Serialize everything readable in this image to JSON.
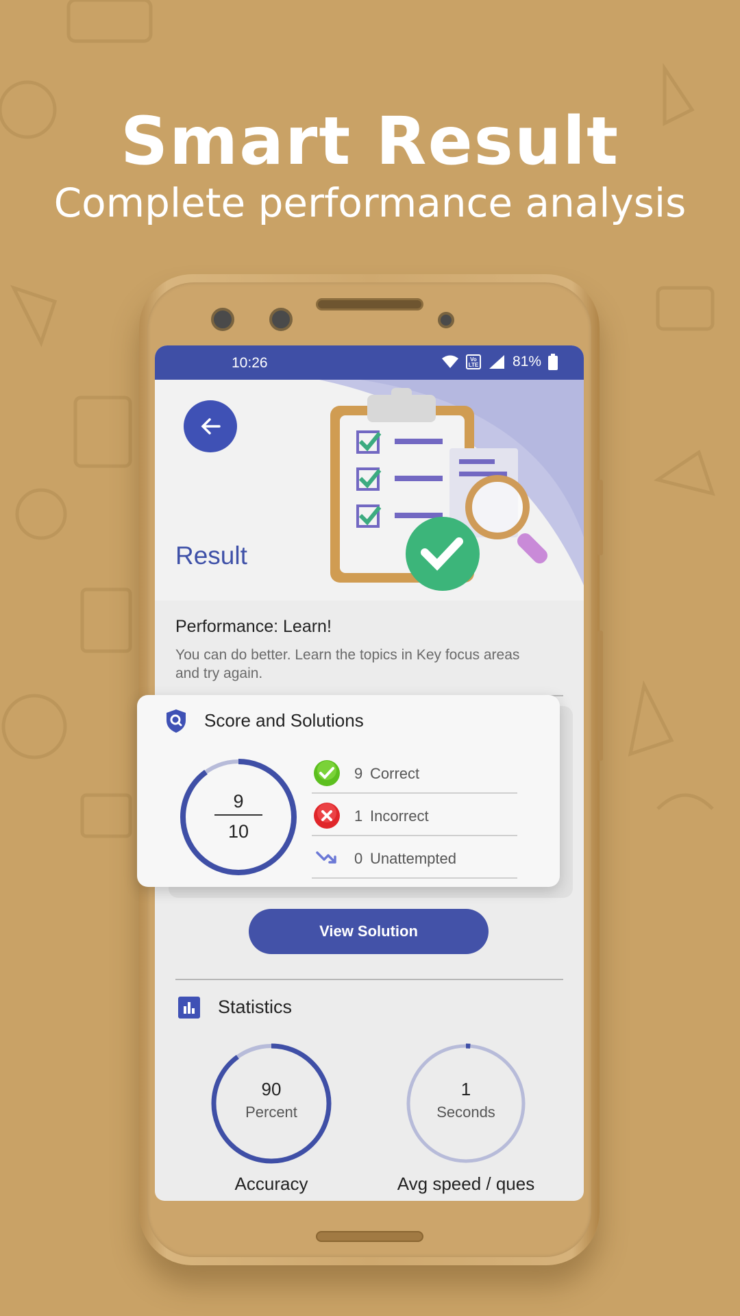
{
  "promo": {
    "headline": "Smart Result",
    "subheadline": "Complete performance analysis"
  },
  "status_bar": {
    "time": "10:26",
    "volte": "Vo LTE",
    "battery": "81%"
  },
  "header": {
    "title": "Result"
  },
  "performance": {
    "title": "Performance: Learn!",
    "message": "You can do better. Learn the topics in Key focus areas and try again."
  },
  "score_card": {
    "title": "Score and Solutions",
    "score": "9",
    "total": "10",
    "score_fraction": 0.9,
    "rows": [
      {
        "count": "9",
        "label": "Correct",
        "icon": "check-circle-icon",
        "color": "#5cbf1e"
      },
      {
        "count": "1",
        "label": "Incorrect",
        "icon": "cross-circle-icon",
        "color": "#e0262a"
      },
      {
        "count": "0",
        "label": "Unattempted",
        "icon": "trend-down-icon",
        "color": "#6b78d6"
      }
    ]
  },
  "actions": {
    "view_solution": "View Solution"
  },
  "statistics": {
    "title": "Statistics",
    "items": [
      {
        "value": "90",
        "unit": "Percent",
        "label": "Accuracy",
        "fraction": 0.9
      },
      {
        "value": "1",
        "unit": "Seconds",
        "label": "Avg speed / ques",
        "fraction": 0.01
      }
    ]
  },
  "colors": {
    "background": "#c9a266",
    "primary": "#3f51b5",
    "status_bar": "#3f4fa6"
  }
}
